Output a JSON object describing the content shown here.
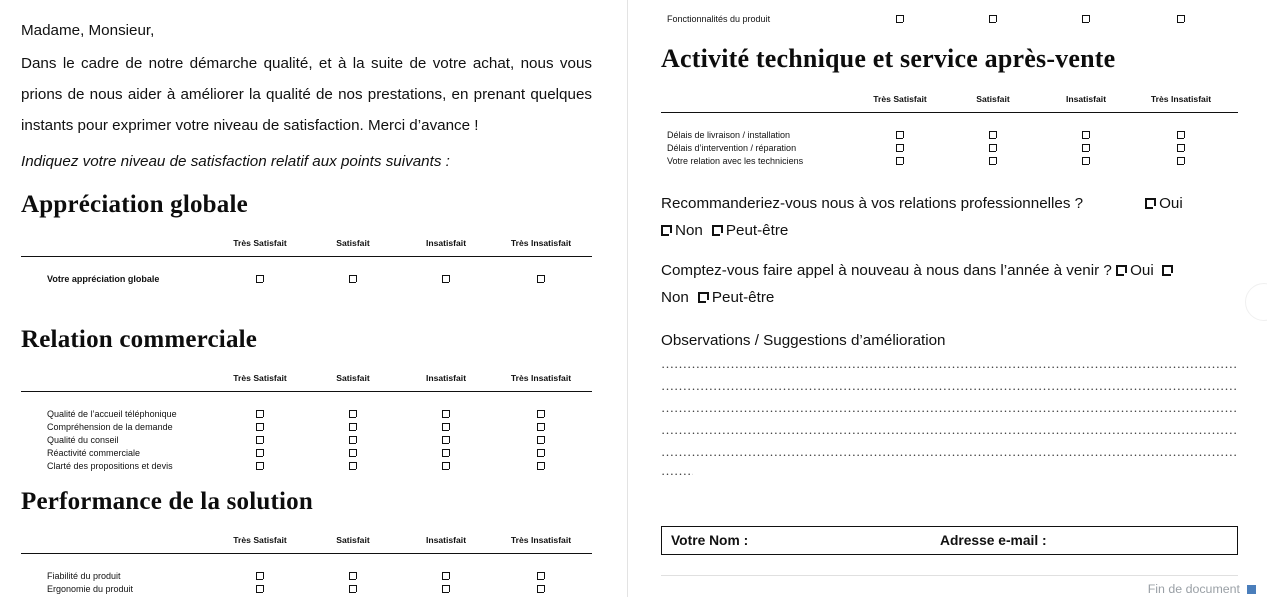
{
  "document": {
    "salutation": "Madame, Monsieur,",
    "intro_paragraph": "Dans le cadre de notre démarche qualité, et à la suite de votre achat, nous vous prions de nous aider à améliorer la qualité de nos prestations, en prenant quelques instants pour exprimer votre niveau de satisfaction. Merci d’avance !",
    "instruction": "Indiquez votre niveau de satisfaction relatif aux points suivants :"
  },
  "scale": {
    "columns": [
      "Très Satisfait",
      "Satisfait",
      "Insatisfait",
      "Très Insatisfait"
    ]
  },
  "sections": {
    "appreciation_globale": {
      "heading": "Appréciation globale",
      "rows": [
        "Votre appréciation globale"
      ]
    },
    "relation_commerciale": {
      "heading": "Relation commerciale",
      "rows": [
        "Qualité de l’accueil téléphonique",
        "Compréhension de la demande",
        "Qualité du conseil",
        "Réactivité commerciale",
        "Clarté des propositions et devis"
      ]
    },
    "performance_solution": {
      "heading": "Performance de la solution",
      "rows": [
        "Fiabilité du produit",
        "Ergonomie du produit",
        "Fonctionnalités du produit"
      ]
    },
    "activite_technique": {
      "heading": "Activité technique et service après-vente",
      "rows": [
        "Délais de livraison / installation",
        "Délais d’intervention / réparation",
        "Votre relation avec les techniciens"
      ]
    }
  },
  "questions": [
    {
      "text": "Recommanderiez-vous nous à vos relations professionnelles ?",
      "options": [
        "Oui",
        "Non",
        "Peut-être"
      ]
    },
    {
      "text": "Comptez-vous faire appel à nouveau à nous dans l’année à venir ?",
      "options": [
        "Oui",
        "Non",
        "Peut-être"
      ]
    }
  ],
  "observations": {
    "heading": "Observations / Suggestions d’amélioration",
    "lines": [
      "……………………………………………………………………………………………………………………………………………………………………………………………………………………………………………………………………………………",
      "……………………………………………………………………………………………………………………………………………………………………………………………………………………………………………………………………………………",
      "……………………………………………………………………………………………………………………………………………………………………………………………………………………………………………………………………………………",
      "……………………………………………………………………………………………………………………………………………………………………………………………………………………………………………………………………………………",
      "……………………………………………………………………………………………………………………………………………………………………………………………………………………………………………………………………………………",
      "………"
    ]
  },
  "contact": {
    "name_label": "Votre Nom :",
    "email_label": "Adresse e-mail :"
  },
  "footer": {
    "end_marker": "Fin de document",
    "marker_color": "#4a7ebb"
  }
}
